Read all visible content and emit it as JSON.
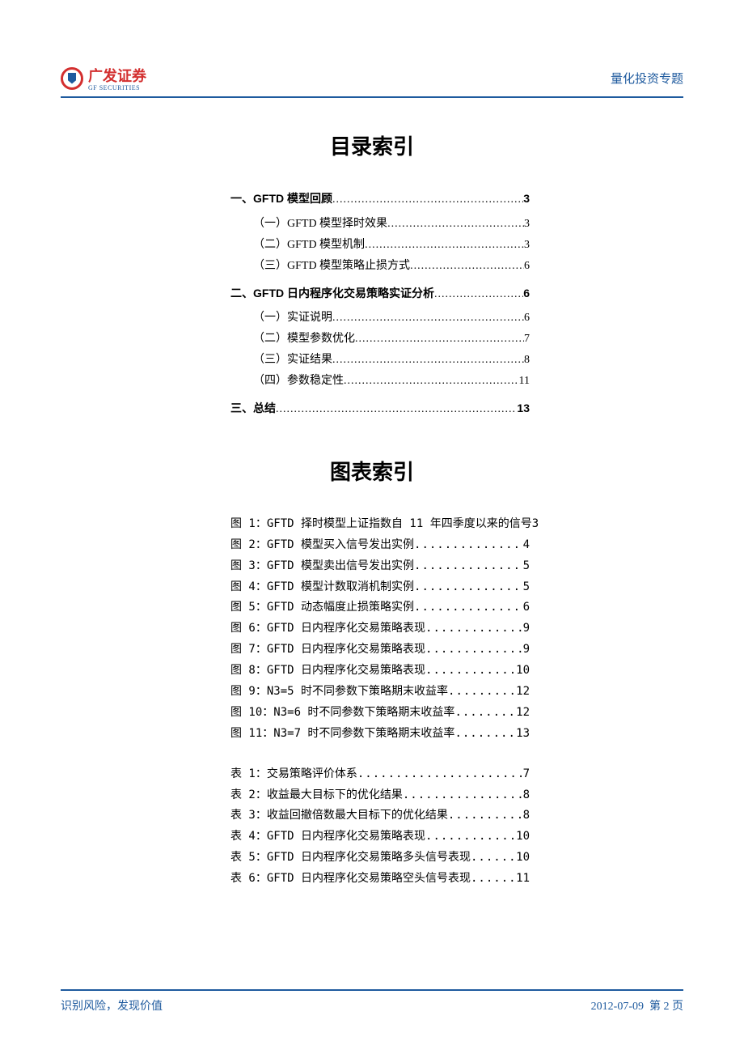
{
  "header": {
    "logo_cn": "广发证券",
    "logo_en": "GF SECURITIES",
    "topic": "量化投资专题"
  },
  "titles": {
    "contents": "目录索引",
    "figures": "图表索引"
  },
  "toc": [
    {
      "level": 1,
      "label": "一、GFTD 模型回顾",
      "page": "3"
    },
    {
      "level": 2,
      "label": "（一）GFTD 模型择时效果",
      "page": "3"
    },
    {
      "level": 2,
      "label": "（二）GFTD 模型机制",
      "page": "3"
    },
    {
      "level": 2,
      "label": "（三）GFTD 模型策略止损方式",
      "page": "6"
    },
    {
      "level": 1,
      "label": "二、GFTD 日内程序化交易策略实证分析",
      "page": "6"
    },
    {
      "level": 2,
      "label": "（一）实证说明",
      "page": "6"
    },
    {
      "level": 2,
      "label": "（二）模型参数优化",
      "page": "7"
    },
    {
      "level": 2,
      "label": "（三）实证结果",
      "page": "8"
    },
    {
      "level": 2,
      "label": "（四）参数稳定性",
      "page": "11"
    },
    {
      "level": 1,
      "label": "三、总结",
      "page": "13"
    }
  ],
  "figures": [
    {
      "label": "图 1：GFTD 择时模型上证指数自 11 年四季度以来的信号",
      "page": "3"
    },
    {
      "label": "图 2：GFTD 模型买入信号发出实例",
      "page": "4"
    },
    {
      "label": "图 3：GFTD 模型卖出信号发出实例",
      "page": "5"
    },
    {
      "label": "图 4：GFTD 模型计数取消机制实例",
      "page": "5"
    },
    {
      "label": "图 5：GFTD 动态幅度止损策略实例",
      "page": "6"
    },
    {
      "label": "图 6：GFTD 日内程序化交易策略表现",
      "page": "9"
    },
    {
      "label": "图 7：GFTD 日内程序化交易策略表现",
      "page": "9"
    },
    {
      "label": "图 8：GFTD 日内程序化交易策略表现",
      "page": "10"
    },
    {
      "label": "图 9：N3=5 时不同参数下策略期末收益率",
      "page": "12"
    },
    {
      "label": "图 10：N3=6 时不同参数下策略期末收益率",
      "page": "12"
    },
    {
      "label": "图 11：N3=7 时不同参数下策略期末收益率",
      "page": "13"
    }
  ],
  "tables": [
    {
      "label": "表 1：交易策略评价体系",
      "page": "7"
    },
    {
      "label": "表 2：收益最大目标下的优化结果",
      "page": "8"
    },
    {
      "label": "表 3：收益回撤倍数最大目标下的优化结果",
      "page": "8"
    },
    {
      "label": "表 4：GFTD 日内程序化交易策略表现",
      "page": "10"
    },
    {
      "label": "表 5：GFTD 日内程序化交易策略多头信号表现",
      "page": "10"
    },
    {
      "label": "表 6：GFTD 日内程序化交易策略空头信号表现",
      "page": "11"
    }
  ],
  "footer": {
    "left": "识别风险，发现价值",
    "date": "2012-07-09",
    "page": "第 2 页"
  }
}
